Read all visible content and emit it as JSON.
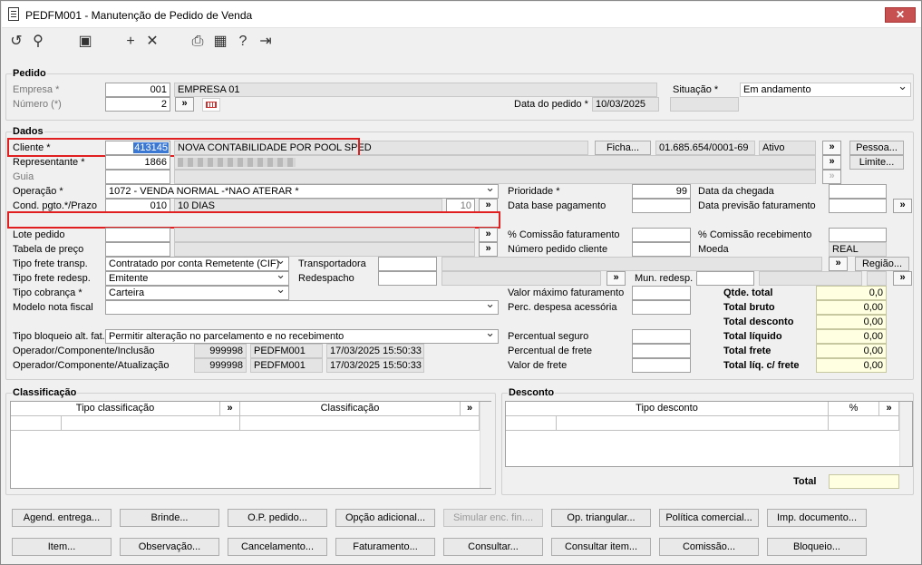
{
  "window": {
    "title": "PEDFM001 - Manutenção de Pedido de Venda"
  },
  "pedido": {
    "group": "Pedido",
    "empresa_label": "Empresa *",
    "empresa_code": "001",
    "empresa_name": "EMPRESA 01",
    "numero_label": "Número (*)",
    "numero": "2",
    "situacao_label": "Situação *",
    "situacao": "Em andamento",
    "data_label": "Data do pedido *",
    "data": "10/03/2025"
  },
  "dados": {
    "group": "Dados",
    "cliente_label": "Cliente *",
    "cliente_code": "413145",
    "cliente_name": "NOVA CONTABILIDADE POR POOL SPED",
    "ficha": "Ficha...",
    "cnpj": "01.685.654/0001-69",
    "status": "Ativo",
    "pessoa": "Pessoa...",
    "limite": "Limite...",
    "representante_label": "Representante *",
    "representante_code": "1866",
    "guia_label": "Guia",
    "operacao_label": "Operação *",
    "operacao": "1072 - VENDA NORMAL -*NAO ATERAR *",
    "condpgto_label": "Cond. pgto.*/Prazo",
    "condpgto_code": "010",
    "condpgto_name": "10 DIAS",
    "prazo": "10",
    "lote_label": "Lote pedido",
    "tabela_label": "Tabela de preço",
    "fretetransp_label": "Tipo frete transp.",
    "fretetransp": "Contratado por conta Remetente (CIF)",
    "freteredesp_label": "Tipo frete redesp.",
    "freteredesp": "Emitente",
    "cobranca_label": "Tipo cobrança *",
    "cobranca": "Carteira",
    "modelonf_label": "Modelo nota fiscal",
    "transportadora_label": "Transportadora",
    "redespacho_label": "Redespacho",
    "munredesp_label": "Mun. redesp.",
    "regiao": "Região...",
    "bloqueio_label": "Tipo bloqueio alt. fat.",
    "bloqueio": "Permitir alteração no parcelamento e no recebimento",
    "opinc_label": "Operador/Componente/Inclusão",
    "opinc_code": "999998",
    "opinc_comp": "PEDFM001",
    "opinc_date": "17/03/2025 15:50:33",
    "opatu_label": "Operador/Componente/Atualização",
    "opatu_code": "999998",
    "opatu_comp": "PEDFM001",
    "opatu_date": "17/03/2025 15:50:33",
    "prioridade_label": "Prioridade *",
    "prioridade": "99",
    "database_label": "Data base pagamento",
    "comfat_label": "% Comissão faturamento",
    "numcli_label": "Número pedido cliente",
    "valmax_label": "Valor máximo faturamento",
    "percdesp_label": "Perc. despesa acessória",
    "percseg_label": "Percentual seguro",
    "percfrete_label": "Percentual de frete",
    "valfrete_label": "Valor de frete",
    "datachegada_label": "Data da chegada",
    "dataprev_label": "Data previsão faturamento",
    "comrec_label": "% Comissão recebimento",
    "moeda_label": "Moeda",
    "moeda": "REAL",
    "totals": [
      {
        "label": "Qtde. total",
        "value": "0,0"
      },
      {
        "label": "Total bruto",
        "value": "0,00"
      },
      {
        "label": "Total desconto",
        "value": "0,00"
      },
      {
        "label": "Total líquido",
        "value": "0,00"
      },
      {
        "label": "Total frete",
        "value": "0,00"
      },
      {
        "label": "Total líq. c/ frete",
        "value": "0,00"
      }
    ]
  },
  "classificacao": {
    "group": "Classificação",
    "col1": "Tipo classificação",
    "col2": "Classificação"
  },
  "desconto": {
    "group": "Desconto",
    "col1": "Tipo desconto",
    "col2": "%",
    "total_label": "Total"
  },
  "buttons_row1": [
    "Agend. entrega...",
    "Brinde...",
    "O.P. pedido...",
    "Opção adicional...",
    "Simular enc. fin....",
    "Op. triangular...",
    "Política comercial...",
    "Imp. documento..."
  ],
  "buttons_row2": [
    "Item...",
    "Observação...",
    "Cancelamento...",
    "Faturamento...",
    "Consultar...",
    "Consultar item...",
    "Comissão...",
    "Bloqueio..."
  ],
  "accent": "#e02020"
}
